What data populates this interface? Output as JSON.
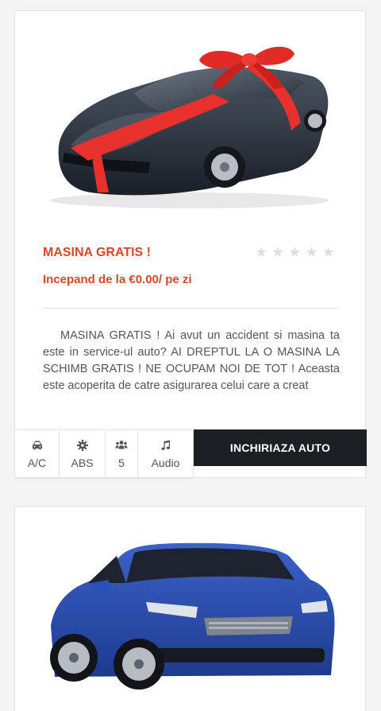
{
  "listings": [
    {
      "title": "MASINA GRATIS !",
      "rating_stars": 0,
      "rating_max": 5,
      "price_text": "Incepand de la €0.00/ pe zi",
      "description": "MASINA GRATIS ! Ai avut un accident si masina ta este in service-ul auto? AI DREPTUL LA O MASINA LA SCHIMB GRATIS ! NE OCUPAM NOI DE TOT ! Aceasta este acoperita de catre asigurarea celui care a creat",
      "features": [
        {
          "icon": "car-icon",
          "label": "A/C"
        },
        {
          "icon": "gear-icon",
          "label": "ABS"
        },
        {
          "icon": "users-icon",
          "label": "5"
        },
        {
          "icon": "music-note-icon",
          "label": "Audio"
        }
      ],
      "button_label": "INCHIRIAZA AUTO",
      "image": "dark sports car wrapped with red ribbon bow"
    },
    {
      "image": "blue hatchback car"
    }
  ],
  "colors": {
    "accent": "#d24a2b",
    "button_bg": "#1c1f24",
    "star_inactive": "#dedede",
    "page_bg": "#f4f4f4"
  }
}
